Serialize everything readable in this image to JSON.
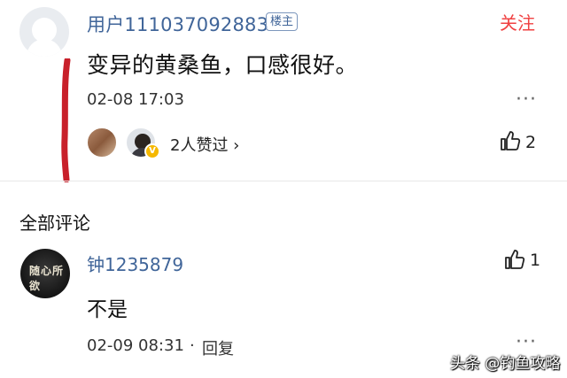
{
  "post": {
    "username": "用户111037092883",
    "op_badge": "楼主",
    "follow_label": "关注",
    "text": "变异的黄桑鱼，口感很好。",
    "time": "02-08 17:03",
    "more": "···",
    "likers_text": "2人赞过 ›",
    "like_count": "2",
    "verified_badge": "V"
  },
  "comments_section": {
    "title": "全部评论",
    "comments": [
      {
        "username": "钟1235879",
        "avatar_text": "随心所欲",
        "like_count": "1",
        "text": "不是",
        "time": "02-09 08:31",
        "separator": "·",
        "reply_label": "回复",
        "more": "···"
      }
    ]
  },
  "watermark": "头条 @钓鱼攻略",
  "colors": {
    "username": "#406599",
    "follow": "#f04142",
    "red_mark": "#c8202a"
  }
}
